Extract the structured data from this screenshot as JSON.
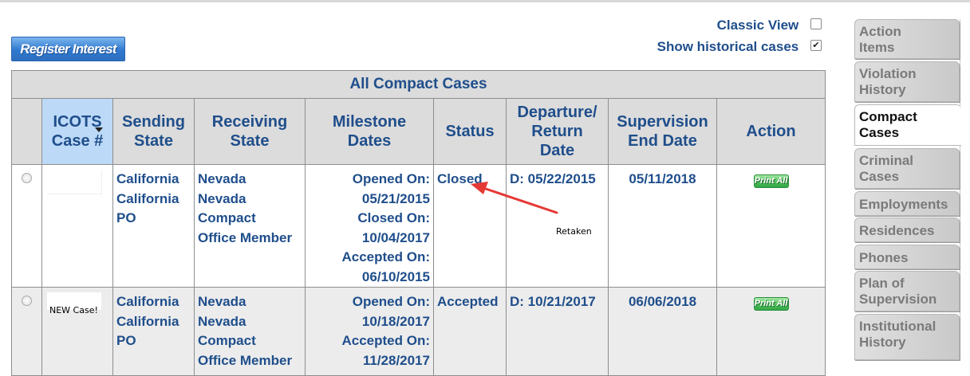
{
  "register_button": {
    "label": "Register Interest"
  },
  "options": {
    "classic_view": {
      "label": "Classic View",
      "checked": false
    },
    "show_historical": {
      "label": "Show historical cases",
      "checked": true,
      "mark": "✔"
    }
  },
  "table": {
    "title": "All Compact Cases",
    "headers": {
      "case_line1": "ICOTS",
      "case_line2": "Case #",
      "sending_line1": "Sending",
      "sending_line2": "State",
      "receiving_line1": "Receiving",
      "receiving_line2": "State",
      "milestone_line1": "Milestone",
      "milestone_line2": "Dates",
      "status": "Status",
      "departure_line1": "Departure/",
      "departure_line2": "Return",
      "departure_line3": "Date",
      "supervision_line1": "Supervision",
      "supervision_line2": "End Date",
      "action": "Action"
    },
    "rows": [
      {
        "case_note": "",
        "sending": [
          "California",
          "California",
          "PO"
        ],
        "receiving": [
          "Nevada",
          "Nevada",
          "Compact",
          "Office Member"
        ],
        "milestones": [
          "Opened On:",
          "05/21/2015",
          "Closed On:",
          "10/04/2017",
          "Accepted On:",
          "06/10/2015"
        ],
        "status": "Closed",
        "departure": "D:  05/22/2015",
        "supervision_end": "05/11/2018",
        "action": "Print All",
        "annotation": "Retaken"
      },
      {
        "case_note": "NEW Case!",
        "sending": [
          "California",
          "California",
          "PO"
        ],
        "receiving": [
          "Nevada",
          "Nevada",
          "Compact",
          "Office Member"
        ],
        "milestones": [
          "Opened On:",
          "10/18/2017",
          "Accepted On:",
          "11/28/2017"
        ],
        "status": "Accepted",
        "departure": "D:  10/21/2017",
        "supervision_end": "06/06/2018",
        "action": "Print All"
      }
    ]
  },
  "tabs": [
    {
      "line1": "Action",
      "line2": "Items"
    },
    {
      "line1": "Violation",
      "line2": "History"
    },
    {
      "line1": "Compact",
      "line2": "Cases",
      "active": true
    },
    {
      "line1": "Criminal",
      "line2": "Cases"
    },
    {
      "line1": "Employments"
    },
    {
      "line1": "Residences"
    },
    {
      "line1": "Phones"
    },
    {
      "line1": "Plan of",
      "line2": "Supervision"
    },
    {
      "line1": "Institutional",
      "line2": "History"
    }
  ],
  "colors": {
    "text_blue": "#1f4e8b",
    "header_gray": "#dcdcdc",
    "sorted_header": "#bcd9f7",
    "arrow_red": "#e53935"
  },
  "icons": {
    "sort": "sort-desc-icon",
    "checkbox": "checkbox-icon",
    "radio": "radio-icon"
  }
}
